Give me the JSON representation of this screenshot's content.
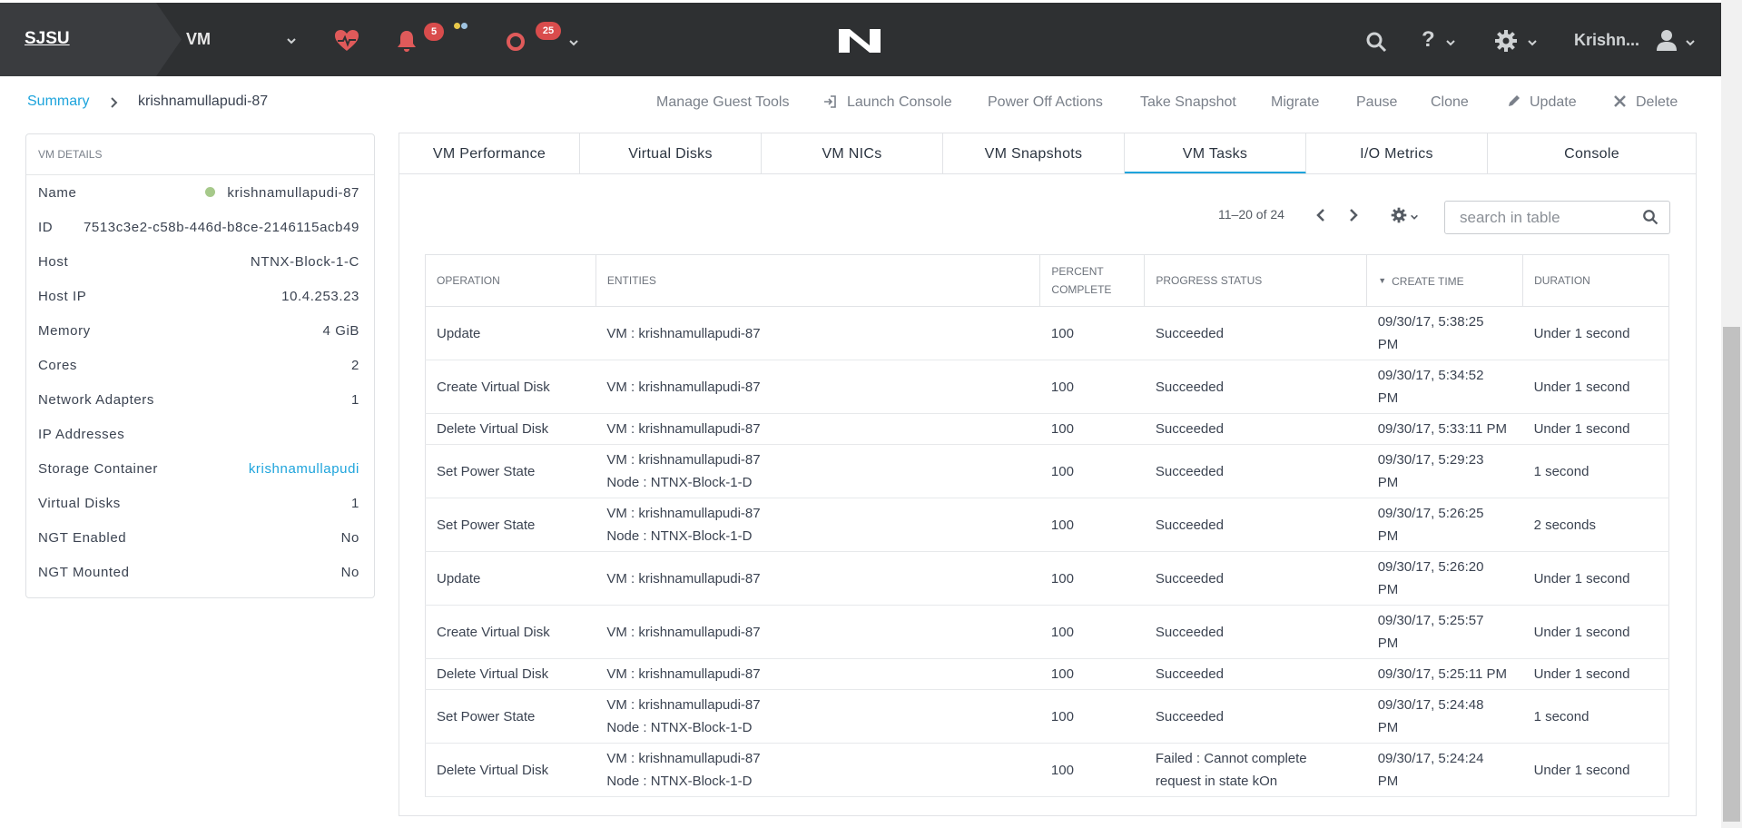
{
  "topbar": {
    "brand": "SJSU",
    "vm_selector": "VM",
    "alerts_count": "5",
    "tasks_count": "25",
    "user": "Krishn..."
  },
  "breadcrumb": {
    "root": "Summary",
    "current": "krishnamullapudi-87"
  },
  "actions": {
    "manage_guest_tools": "Manage Guest Tools",
    "launch_console": "Launch Console",
    "power_off": "Power Off Actions",
    "take_snapshot": "Take Snapshot",
    "migrate": "Migrate",
    "pause": "Pause",
    "clone": "Clone",
    "update": "Update",
    "delete": "Delete"
  },
  "vm_details": {
    "header": "VM DETAILS",
    "rows": [
      {
        "key": "Name",
        "value": "krishnamullapudi-87"
      },
      {
        "key": "ID",
        "value": "7513c3e2-c58b-446d-b8ce-2146115acb49"
      },
      {
        "key": "Host",
        "value": "NTNX-Block-1-C"
      },
      {
        "key": "Host IP",
        "value": "10.4.253.23"
      },
      {
        "key": "Memory",
        "value": "4 GiB"
      },
      {
        "key": "Cores",
        "value": "2"
      },
      {
        "key": "Network Adapters",
        "value": "1"
      },
      {
        "key": "IP Addresses",
        "value": ""
      },
      {
        "key": "Storage Container",
        "value": "krishnamullapudi"
      },
      {
        "key": "Virtual Disks",
        "value": "1"
      },
      {
        "key": "NGT Enabled",
        "value": "No"
      },
      {
        "key": "NGT Mounted",
        "value": "No"
      }
    ]
  },
  "tabs": [
    "VM Performance",
    "Virtual Disks",
    "VM NICs",
    "VM Snapshots",
    "VM Tasks",
    "I/O Metrics",
    "Console"
  ],
  "pager": {
    "range": "11–20 of 24",
    "search_placeholder": "search in table"
  },
  "table": {
    "headers": [
      "OPERATION",
      "ENTITIES",
      "PERCENT COMPLETE",
      "PROGRESS STATUS",
      "CREATE TIME",
      "DURATION"
    ],
    "rows": [
      {
        "op": "Update",
        "ent1": "VM : krishnamullapudi-87",
        "ent2": "",
        "pct": "100",
        "status": "Succeeded",
        "time1": "09/30/17, 5:38:25",
        "time2": "PM",
        "dur": "Under 1 second"
      },
      {
        "op": "Create Virtual Disk",
        "ent1": "VM : krishnamullapudi-87",
        "ent2": "",
        "pct": "100",
        "status": "Succeeded",
        "time1": "09/30/17, 5:34:52",
        "time2": "PM",
        "dur": "Under 1 second"
      },
      {
        "op": "Delete Virtual Disk",
        "ent1": "VM : krishnamullapudi-87",
        "ent2": "",
        "pct": "100",
        "status": "Succeeded",
        "time1": "09/30/17, 5:33:11 PM",
        "time2": "",
        "dur": "Under 1 second"
      },
      {
        "op": "Set Power State",
        "ent1": "VM : krishnamullapudi-87",
        "ent2": "Node : NTNX-Block-1-D",
        "pct": "100",
        "status": "Succeeded",
        "time1": "09/30/17, 5:29:23",
        "time2": "PM",
        "dur": "1 second"
      },
      {
        "op": "Set Power State",
        "ent1": "VM : krishnamullapudi-87",
        "ent2": "Node : NTNX-Block-1-D",
        "pct": "100",
        "status": "Succeeded",
        "time1": "09/30/17, 5:26:25",
        "time2": "PM",
        "dur": "2 seconds"
      },
      {
        "op": "Update",
        "ent1": "VM : krishnamullapudi-87",
        "ent2": "",
        "pct": "100",
        "status": "Succeeded",
        "time1": "09/30/17, 5:26:20",
        "time2": "PM",
        "dur": "Under 1 second"
      },
      {
        "op": "Create Virtual Disk",
        "ent1": "VM : krishnamullapudi-87",
        "ent2": "",
        "pct": "100",
        "status": "Succeeded",
        "time1": "09/30/17, 5:25:57",
        "time2": "PM",
        "dur": "Under 1 second"
      },
      {
        "op": "Delete Virtual Disk",
        "ent1": "VM : krishnamullapudi-87",
        "ent2": "",
        "pct": "100",
        "status": "Succeeded",
        "time1": "09/30/17, 5:25:11 PM",
        "time2": "",
        "dur": "Under 1 second"
      },
      {
        "op": "Set Power State",
        "ent1": "VM : krishnamullapudi-87",
        "ent2": "Node : NTNX-Block-1-D",
        "pct": "100",
        "status": "Succeeded",
        "time1": "09/30/17, 5:24:48",
        "time2": "PM",
        "dur": "1 second"
      },
      {
        "op": "Delete Virtual Disk",
        "ent1": "VM : krishnamullapudi-87",
        "ent2": "Node : NTNX-Block-1-D",
        "pct": "100",
        "status": "Failed : Cannot complete",
        "status2": "request in state kOn",
        "time1": "09/30/17, 5:24:24",
        "time2": "PM",
        "dur": "Under 1 second"
      }
    ]
  },
  "colors": {
    "accent": "#1ea4dc",
    "topbar": "#2e3032",
    "badge": "#d94c4c",
    "health": "#e05a5a"
  }
}
